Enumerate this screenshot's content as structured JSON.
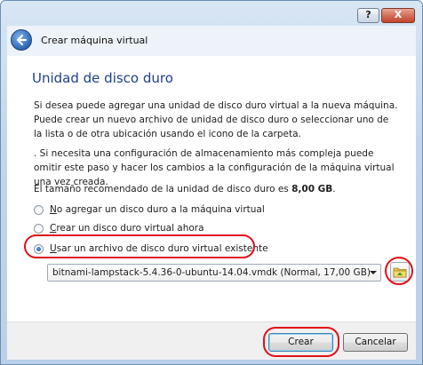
{
  "window": {
    "help_label": "?",
    "close_label": "X"
  },
  "header": {
    "title": "Crear máquina virtual"
  },
  "content": {
    "section_title": "Unidad de disco duro",
    "paragraph1": "Si desea puede agregar una unidad de disco duro virtual a la nueva máquina. Puede crear un nuevo archivo de unidad de disco duro o seleccionar uno de la lista o de otra ubicación usando el icono de la carpeta.",
    "paragraph2": ". Si necesita una configuración de almacenamiento más compleja puede omitir este paso y hacer los cambios a la configuración de la máquina virtual una vez creada.",
    "recommended_prefix": "El tamaño recomendado de la unidad de disco duro es ",
    "recommended_size": "8,00 GB",
    "recommended_suffix": "."
  },
  "options": [
    {
      "label": "No agregar un disco duro a la máquina virtual",
      "checked": false
    },
    {
      "label": "Crear un disco duro virtual ahora",
      "checked": false
    },
    {
      "label": "Usar un archivo de disco duro virtual existente",
      "checked": true
    }
  ],
  "disk_select": {
    "value": "bitnami-lampstack-5.4.36-0-ubuntu-14.04.vmdk (Normal, 17,00 GB)"
  },
  "buttons": {
    "create_label": "Crear",
    "cancel_label": "Cancelar"
  },
  "colors": {
    "highlight": "#e0101a",
    "title_blue": "#1f3f8f"
  }
}
